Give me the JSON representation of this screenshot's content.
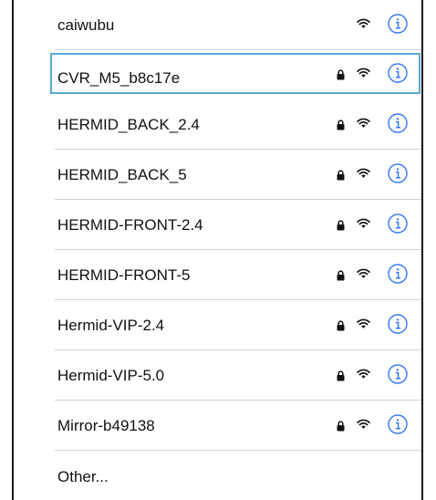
{
  "networks": [
    {
      "name": "caiwubu",
      "secured": false,
      "selected": false
    },
    {
      "name": "CVR_M5_b8c17e",
      "secured": true,
      "selected": true
    },
    {
      "name": "HERMID_BACK_2.4",
      "secured": true,
      "selected": false
    },
    {
      "name": "HERMID_BACK_5",
      "secured": true,
      "selected": false
    },
    {
      "name": "HERMID-FRONT-2.4",
      "secured": true,
      "selected": false
    },
    {
      "name": "HERMID-FRONT-5",
      "secured": true,
      "selected": false
    },
    {
      "name": "Hermid-VIP-2.4",
      "secured": true,
      "selected": false
    },
    {
      "name": "Hermid-VIP-5.0",
      "secured": true,
      "selected": false
    },
    {
      "name": "Mirror-b49138",
      "secured": true,
      "selected": false
    }
  ],
  "other_label": "Other...",
  "icons": {
    "lock": "lock-icon",
    "wifi": "wifi-icon",
    "info": "info-icon"
  },
  "colors": {
    "accent": "#3478f6",
    "highlight_border": "#59a9d4",
    "separator": "#d2d2d6",
    "text": "#111111"
  }
}
